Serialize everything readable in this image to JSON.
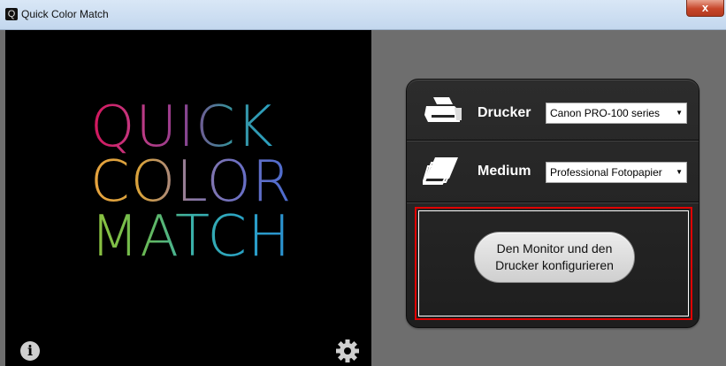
{
  "window": {
    "title": "Quick Color Match",
    "app_icon_letter": "Q",
    "close_label": "x"
  },
  "splash": {
    "logo_lines": [
      "QUICK",
      "COLOR",
      "MATCH"
    ],
    "info_icon": "info-icon",
    "settings_icon": "gear-icon"
  },
  "printer_row": {
    "icon": "printer-icon",
    "label": "Drucker",
    "selected": "Canon PRO-100 series"
  },
  "medium_row": {
    "icon": "paper-stack-icon",
    "label": "Medium",
    "selected": "Professional Fotopapier"
  },
  "action": {
    "button_label": "Den Monitor und den\nDrucker konfigurieren"
  },
  "colors": {
    "highlight": "#e00000",
    "card_bg": "#262626",
    "right_bg": "#6e6e6e"
  }
}
